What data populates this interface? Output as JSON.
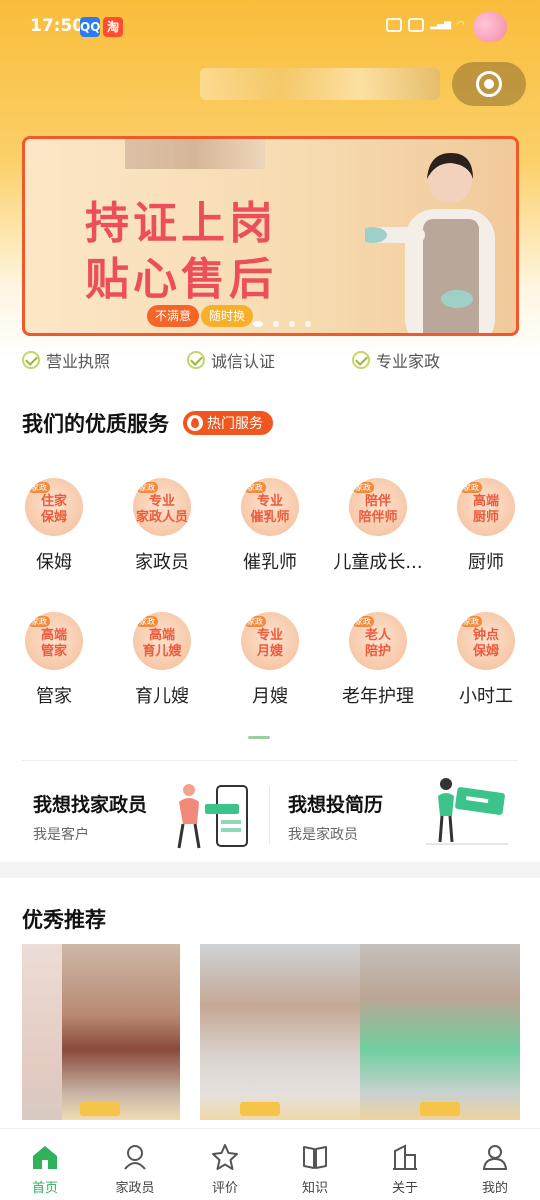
{
  "status_bar": {
    "time": "17:50",
    "apps": [
      "QQ",
      "淘"
    ]
  },
  "banner": {
    "line1": "持证上岗",
    "line2": "贴心售后",
    "tag1": "不满意",
    "tag2": "随时换",
    "slide_count": 4,
    "active_slide": 0
  },
  "trust_badges": [
    "营业执照",
    "诚信认证",
    "专业家政"
  ],
  "services_section": {
    "title": "我们的优质服务",
    "hot_label": "热门服务"
  },
  "services": [
    {
      "label": "保姆",
      "icon_text": "住家\n保姆"
    },
    {
      "label": "家政员",
      "icon_text": "专业\n家政人员"
    },
    {
      "label": "催乳师",
      "icon_text": "专业\n催乳师"
    },
    {
      "label": "儿童成长...",
      "icon_text": "陪伴\n陪伴师"
    },
    {
      "label": "厨师",
      "icon_text": "高端\n厨师"
    },
    {
      "label": "管家",
      "icon_text": "高端\n管家"
    },
    {
      "label": "育儿嫂",
      "icon_text": "高端\n育儿嫂"
    },
    {
      "label": "月嫂",
      "icon_text": "专业\n月嫂"
    },
    {
      "label": "老年护理",
      "icon_text": "老人\n陪护"
    },
    {
      "label": "小时工",
      "icon_text": "钟点\n保姆"
    }
  ],
  "actions": [
    {
      "title": "我想找家政员",
      "subtitle": "我是客户"
    },
    {
      "title": "我想投简历",
      "subtitle": "我是家政员"
    }
  ],
  "recommend": {
    "title": "优秀推荐"
  },
  "bottom_nav": [
    {
      "label": "首页",
      "icon": "home-icon",
      "active": true
    },
    {
      "label": "家政员",
      "icon": "worker-icon",
      "active": false
    },
    {
      "label": "评价",
      "icon": "star-icon",
      "active": false
    },
    {
      "label": "知识",
      "icon": "book-icon",
      "active": false
    },
    {
      "label": "关于",
      "icon": "building-icon",
      "active": false
    },
    {
      "label": "我的",
      "icon": "user-icon",
      "active": false
    }
  ],
  "colors": {
    "accent_green": "#2fb25a",
    "hot_orange": "#f2561f",
    "header_yellow": "#f9bd3b"
  }
}
